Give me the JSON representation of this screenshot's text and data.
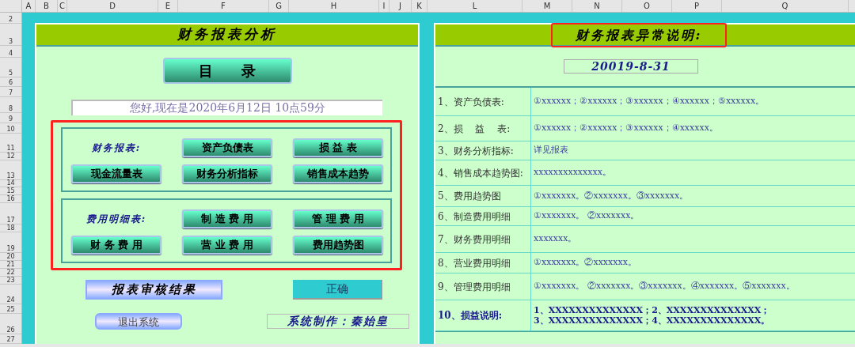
{
  "columns": [
    "A",
    "B",
    "C",
    "D",
    "E",
    "F",
    "G",
    "H",
    "I",
    "J",
    "K",
    "L",
    "M",
    "N",
    "O",
    "P",
    "Q"
  ],
  "rows": [
    "2",
    "3",
    "4",
    "5",
    "6",
    "7",
    "8",
    "9",
    "10",
    "11",
    "12",
    "13",
    "14",
    "15",
    "16",
    "17",
    "18",
    "19",
    "20",
    "21",
    "22",
    "23",
    "24",
    "25",
    "26",
    "27"
  ],
  "left_panel": {
    "title": "财务报表分析",
    "menu_button": "目　　录",
    "greeting": "您好,现在是2020年6月12日 10点59分",
    "groups": [
      {
        "label": "财务报表:",
        "buttons": [
          "资产负债表",
          "损 益 表",
          "现金流量表",
          "财务分析指标",
          "销售成本趋势"
        ]
      },
      {
        "label": "费用明细表:",
        "buttons": [
          "制 造 费 用",
          "管 理 费 用",
          "财 务 费 用",
          "营 业 费 用",
          "费用趋势图"
        ]
      }
    ],
    "audit_label": "报表审核结果",
    "audit_result": "正确",
    "exit_button": "退出系统",
    "author": "系统制作：秦始皇"
  },
  "right_panel": {
    "title": "财务报表异常说明:",
    "date": "20019-8-31",
    "rows": [
      {
        "label": "1、资产负债表:",
        "text": "①xxxxxx；②xxxxxx；③xxxxxx；④xxxxxx；⑤xxxxxx。"
      },
      {
        "label": "2、损　 益　 表:",
        "text": "①xxxxxx；②xxxxxx；③xxxxxx；④xxxxxx。"
      },
      {
        "label": "3、财务分析指标:",
        "text": "详见报表"
      },
      {
        "label": "4、销售成本趋势图:",
        "text": "xxxxxxxxxxxxxx。"
      },
      {
        "label": "5、费用趋势图",
        "text": "①xxxxxxx。②xxxxxxx。③xxxxxxx。"
      },
      {
        "label": "6、制造费用明细",
        "text": "①xxxxxxx。 ②xxxxxxx。"
      },
      {
        "label": "7、财务费用明细",
        "text": "xxxxxxx。"
      },
      {
        "label": "8、营业费用明细",
        "text": "①xxxxxxx。②xxxxxxx。"
      },
      {
        "label": "9、管理费用明细",
        "text": "①xxxxxxx。 ②xxxxxxx。③xxxxxxx。④xxxxxxx。⑤xxxxxxx。"
      },
      {
        "label": "10、损益说明:",
        "text": "1、XXXXXXXXXXXXXX；2、XXXXXXXXXXXXXX；",
        "text2": "3、XXXXXXXXXXXXXX；4、XXXXXXXXXXXXXX。"
      }
    ]
  }
}
